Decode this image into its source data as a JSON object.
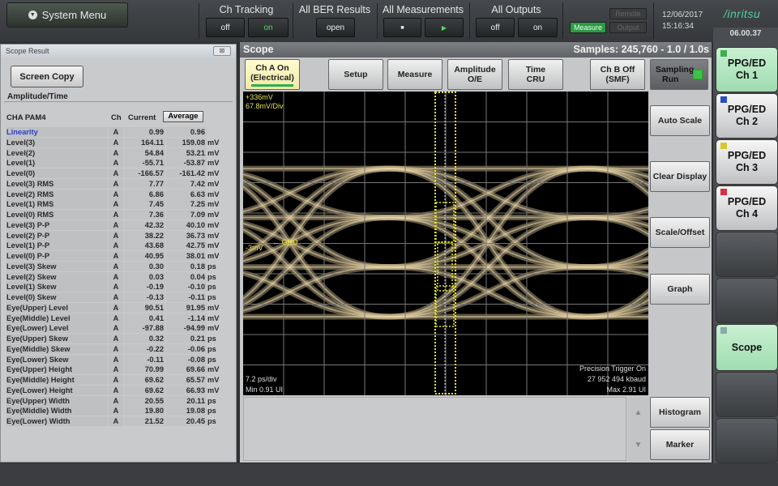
{
  "topbar": {
    "system_menu": "System Menu",
    "ch_tracking": {
      "label": "Ch Tracking",
      "off": "off",
      "on": "on"
    },
    "all_ber": {
      "label": "All BER Results",
      "open": "open"
    },
    "all_meas": {
      "label": "All Measurements",
      "stop": "■",
      "start": "▶"
    },
    "all_outputs": {
      "label": "All Outputs",
      "off": "off",
      "on": "on"
    },
    "remote": "Remote",
    "measure": "Measure",
    "output": "Output",
    "date": "12/06/2017",
    "time": "15:16:34",
    "logo": "/inritsu"
  },
  "colors": {
    "accent_green": "#2fae4e",
    "trace": "#cbb98c",
    "marker": "#e8e51a"
  },
  "left": {
    "title": "Scope Result",
    "close": "⊠",
    "screen_copy": "Screen Copy",
    "group": "Amplitude/Time",
    "header": {
      "name": "CHA PAM4",
      "ch": "Ch",
      "current": "Current",
      "average": "Average"
    },
    "rows": [
      [
        "Linearity",
        "A",
        "0.99",
        "0.96",
        ""
      ],
      [
        "Level(3)",
        "A",
        "164.11",
        "159.08",
        "mV"
      ],
      [
        "Level(2)",
        "A",
        "54.84",
        "53.21",
        "mV"
      ],
      [
        "Level(1)",
        "A",
        "-55.71",
        "-53.87",
        "mV"
      ],
      [
        "Level(0)",
        "A",
        "-166.57",
        "-161.42",
        "mV"
      ],
      [
        "Level(3) RMS",
        "A",
        "7.77",
        "7.42",
        "mV"
      ],
      [
        "Level(2) RMS",
        "A",
        "6.86",
        "6.63",
        "mV"
      ],
      [
        "Level(1) RMS",
        "A",
        "7.45",
        "7.25",
        "mV"
      ],
      [
        "Level(0) RMS",
        "A",
        "7.36",
        "7.09",
        "mV"
      ],
      [
        "Level(3) P-P",
        "A",
        "42.32",
        "40.10",
        "mV"
      ],
      [
        "Level(2) P-P",
        "A",
        "38.22",
        "36.73",
        "mV"
      ],
      [
        "Level(1) P-P",
        "A",
        "43.68",
        "42.75",
        "mV"
      ],
      [
        "Level(0) P-P",
        "A",
        "40.95",
        "38.01",
        "mV"
      ],
      [
        "Level(3) Skew",
        "A",
        "0.30",
        "0.18",
        "ps"
      ],
      [
        "Level(2) Skew",
        "A",
        "0.03",
        "0.04",
        "ps"
      ],
      [
        "Level(1) Skew",
        "A",
        "-0.19",
        "-0.10",
        "ps"
      ],
      [
        "Level(0) Skew",
        "A",
        "-0.13",
        "-0.11",
        "ps"
      ],
      [
        "Eye(Upper)  Level",
        "A",
        "90.51",
        "91.95",
        "mV"
      ],
      [
        "Eye(Middle) Level",
        "A",
        "0.41",
        "-1.14",
        "mV"
      ],
      [
        "Eye(Lower)  Level",
        "A",
        "-97.88",
        "-94.99",
        "mV"
      ],
      [
        "Eye(Upper)  Skew",
        "A",
        "0.32",
        "0.21",
        "ps"
      ],
      [
        "Eye(Middle) Skew",
        "A",
        "-0.22",
        "-0.06",
        "ps"
      ],
      [
        "Eye(Lower)  Skew",
        "A",
        "-0.11",
        "-0.08",
        "ps"
      ],
      [
        "Eye(Upper)  Height",
        "A",
        "70.99",
        "69.66",
        "mV"
      ],
      [
        "Eye(Middle) Height",
        "A",
        "69.62",
        "65.57",
        "mV"
      ],
      [
        "Eye(Lower)  Height",
        "A",
        "69.62",
        "66.93",
        "mV"
      ],
      [
        "Eye(Upper)  Width",
        "A",
        "20.55",
        "20.11",
        "ps"
      ],
      [
        "Eye(Middle) Width",
        "A",
        "19.80",
        "19.08",
        "ps"
      ],
      [
        "Eye(Lower)  Width",
        "A",
        "21.52",
        "20.45",
        "ps"
      ]
    ]
  },
  "scope": {
    "title": "Scope",
    "samples": "Samples: 245,760 - 1.0 / 1.0s",
    "buttons": {
      "cha": [
        "Ch A On",
        "(Electrical)"
      ],
      "setup": "Setup",
      "measure": "Measure",
      "amplitude": [
        "Amplitude",
        "O/E"
      ],
      "time": [
        "Time",
        "CRU"
      ],
      "chb": [
        "Ch B Off",
        "(SMF)"
      ],
      "sampling": [
        "Sampling",
        "Run"
      ]
    },
    "plot": {
      "top": "+336mV",
      "scale": "67.8mV/Div",
      "offset": "-3mV",
      "gnd": "← GND",
      "timebase": "7.2 ps/div",
      "min": "Min 0.91 UI",
      "precision": "Precision Trigger On",
      "baud": "27 952 494 kbaud",
      "max": "Max 2.91 UI",
      "top_mv": 336,
      "mv_per_div": 67.8
    },
    "right": {
      "auto_scale": "Auto Scale",
      "clear_display": "Clear Display",
      "scale_offset": "Scale/Offset",
      "graph": "Graph",
      "histogram": "Histogram",
      "marker": "Marker",
      "up": "▲",
      "down": "▼"
    }
  },
  "side": {
    "version": "06.00.37",
    "items": [
      {
        "l1": "PPG/ED",
        "l2": "Ch 1",
        "color": "#3fae4e"
      },
      {
        "l1": "PPG/ED",
        "l2": "Ch 2",
        "color": "#2a4fc0"
      },
      {
        "l1": "PPG/ED",
        "l2": "Ch 3",
        "color": "#d8c62a"
      },
      {
        "l1": "PPG/ED",
        "l2": "Ch 4",
        "color": "#d83040"
      }
    ],
    "scope": "Scope"
  }
}
